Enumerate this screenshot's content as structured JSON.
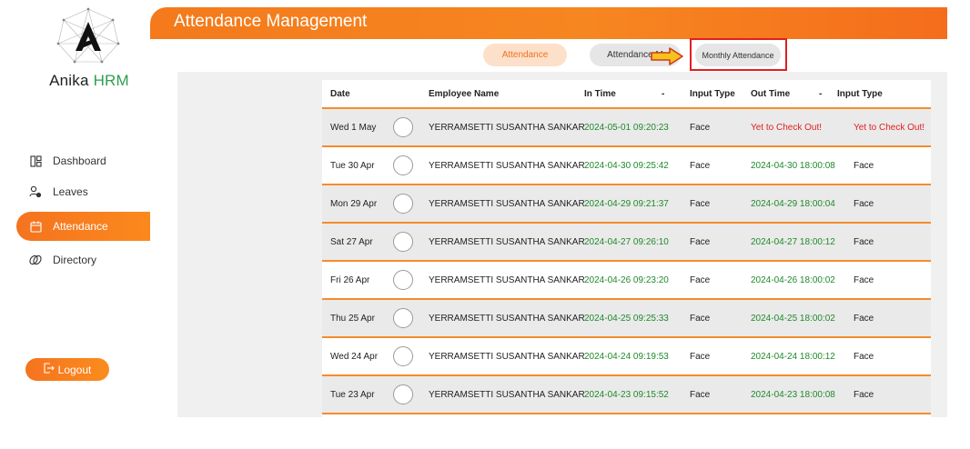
{
  "brand": {
    "name_part1": "Anika",
    "name_part2": "HRM"
  },
  "header": {
    "title": "Attendance Management"
  },
  "sidebar": {
    "items": [
      {
        "label": "Dashboard",
        "icon": "dashboard-icon"
      },
      {
        "label": "Leaves",
        "icon": "leaves-icon"
      },
      {
        "label": "Attendance",
        "icon": "calendar-icon",
        "active": true
      },
      {
        "label": "Directory",
        "icon": "directory-icon"
      }
    ],
    "logout_label": "Logout"
  },
  "tabs": {
    "attendance": "Attendance",
    "attendance_m": "Attendance M",
    "monthly": "Monthly Attendance"
  },
  "table": {
    "headers": {
      "date": "Date",
      "employee": "Employee Name",
      "in_time": "In Time",
      "dash1": "-",
      "in_type": "Input Type",
      "out_time": "Out Time",
      "dash2": "-",
      "out_type": "Input Type"
    },
    "rows": [
      {
        "date": "Wed 1 May",
        "name": "YERRAMSETTI SUSANTHA SANKAR",
        "in_time": "2024-05-01 09:20:23",
        "in_type": "Face",
        "out_time": "Yet to Check Out!",
        "out_type": "Yet to Check Out!"
      },
      {
        "date": "Tue 30 Apr",
        "name": "YERRAMSETTI SUSANTHA SANKAR",
        "in_time": "2024-04-30 09:25:42",
        "in_type": "Face",
        "out_time": "2024-04-30 18:00:08",
        "out_type": "Face"
      },
      {
        "date": "Mon 29 Apr",
        "name": "YERRAMSETTI SUSANTHA SANKAR",
        "in_time": "2024-04-29 09:21:37",
        "in_type": "Face",
        "out_time": "2024-04-29 18:00:04",
        "out_type": "Face"
      },
      {
        "date": "Sat 27 Apr",
        "name": "YERRAMSETTI SUSANTHA SANKAR",
        "in_time": "2024-04-27 09:26:10",
        "in_type": "Face",
        "out_time": "2024-04-27 18:00:12",
        "out_type": "Face"
      },
      {
        "date": "Fri 26 Apr",
        "name": "YERRAMSETTI SUSANTHA SANKAR",
        "in_time": "2024-04-26 09:23:20",
        "in_type": "Face",
        "out_time": "2024-04-26 18:00:02",
        "out_type": "Face"
      },
      {
        "date": "Thu 25 Apr",
        "name": "YERRAMSETTI SUSANTHA SANKAR",
        "in_time": "2024-04-25 09:25:33",
        "in_type": "Face",
        "out_time": "2024-04-25 18:00:02",
        "out_type": "Face"
      },
      {
        "date": "Wed 24 Apr",
        "name": "YERRAMSETTI SUSANTHA SANKAR",
        "in_time": "2024-04-24 09:19:53",
        "in_type": "Face",
        "out_time": "2024-04-24 18:00:12",
        "out_type": "Face"
      },
      {
        "date": "Tue 23 Apr",
        "name": "YERRAMSETTI SUSANTHA SANKAR",
        "in_time": "2024-04-23 09:15:52",
        "in_type": "Face",
        "out_time": "2024-04-23 18:00:08",
        "out_type": "Face"
      }
    ]
  },
  "colors": {
    "accent": "#f68620",
    "present": "#1f8a2a",
    "pending": "#e02020"
  }
}
